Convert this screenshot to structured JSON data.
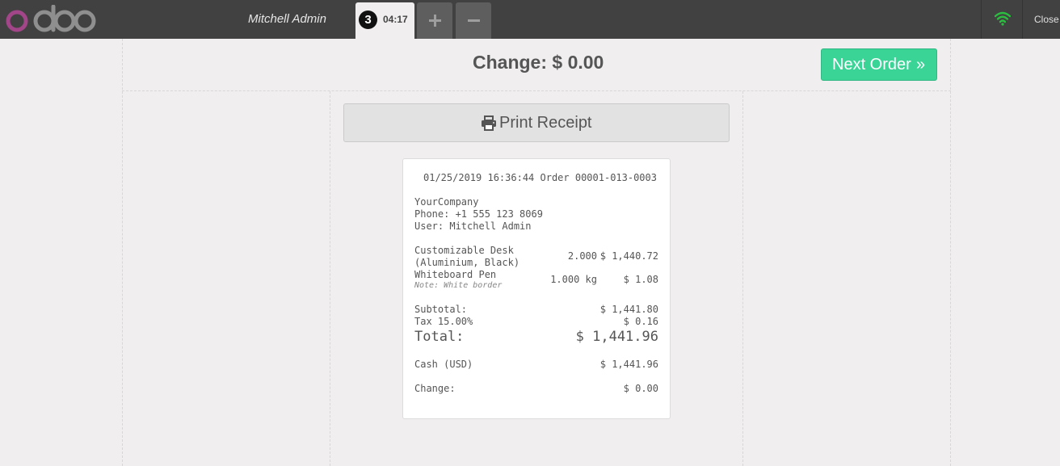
{
  "header": {
    "logo_text": "odoo",
    "user_name": "Mitchell Admin",
    "order_tab": {
      "number": "3",
      "time": "04:17"
    },
    "add_order_label": "+",
    "remove_order_label": "−",
    "close_label": "Close",
    "wifi_color": "#2bbd3f"
  },
  "payment": {
    "change_title": "Change: $ 0.00",
    "next_order_label": "Next Order",
    "next_order_chevron": "»",
    "next_order_color": "#3ad497",
    "print_label": "Print Receipt"
  },
  "receipt": {
    "header_line": "01/25/2019 16:36:44 Order 00001-013-0003",
    "company": "YourCompany",
    "phone": "Phone: +1 555 123 8069",
    "user": "User: Mitchell Admin",
    "lines": [
      {
        "name1": "Customizable Desk",
        "name2": "(Aluminium, Black)",
        "qty": "2.000",
        "price": "$ 1,440.72"
      },
      {
        "name1": "Whiteboard Pen",
        "note": "Note: White border",
        "qty": "1.000 kg",
        "price": "$ 1.08"
      }
    ],
    "subtotal_label": "Subtotal:",
    "subtotal_value": "$ 1,441.80",
    "tax_label": "Tax 15.00%",
    "tax_value": "$ 0.16",
    "total_label": "Total:",
    "total_value": "$ 1,441.96",
    "cash_label": "Cash (USD)",
    "cash_value": "$ 1,441.96",
    "change_label": "Change:",
    "change_value": "$ 0.00"
  }
}
